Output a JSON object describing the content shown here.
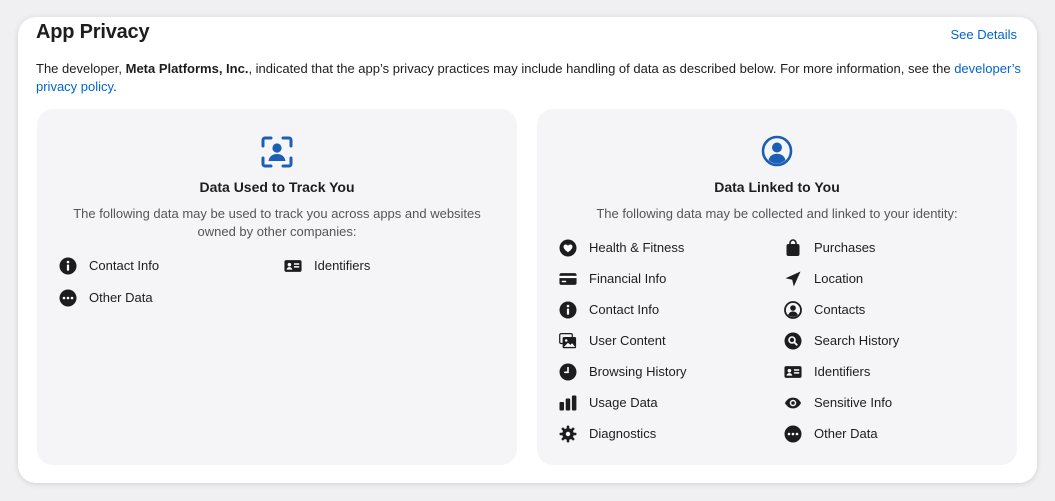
{
  "header": {
    "title": "App Privacy",
    "see_details": "See Details"
  },
  "description": {
    "prefix": "The developer, ",
    "developer": "Meta Platforms, Inc.",
    "middle": ", indicated that the app’s privacy practices may include handling of data as described below. For more information, see the ",
    "link": "developer’s privacy policy",
    "suffix": "."
  },
  "colors": {
    "accent": "#0066cc",
    "panel_bg": "#f5f5f7",
    "icon_blue": "#1a5fb4"
  },
  "track_panel": {
    "icon": "track-you-icon",
    "title": "Data Used to Track You",
    "subtitle": "The following data may be used to track you across apps and websites owned by other companies:",
    "items": [
      {
        "label": "Contact Info",
        "icon": "info-icon"
      },
      {
        "label": "Identifiers",
        "icon": "id-card-icon"
      },
      {
        "label": "Other Data",
        "icon": "ellipsis-icon"
      }
    ]
  },
  "linked_panel": {
    "icon": "person-circle-icon",
    "title": "Data Linked to You",
    "subtitle": "The following data may be collected and linked to your identity:",
    "items": [
      {
        "label": "Health & Fitness",
        "icon": "heart-icon"
      },
      {
        "label": "Purchases",
        "icon": "shopping-bag-icon"
      },
      {
        "label": "Financial Info",
        "icon": "credit-card-icon"
      },
      {
        "label": "Location",
        "icon": "location-arrow-icon"
      },
      {
        "label": "Contact Info",
        "icon": "info-icon"
      },
      {
        "label": "Contacts",
        "icon": "person-circle-icon"
      },
      {
        "label": "User Content",
        "icon": "photo-icon"
      },
      {
        "label": "Search History",
        "icon": "search-icon"
      },
      {
        "label": "Browsing History",
        "icon": "clock-icon"
      },
      {
        "label": "Identifiers",
        "icon": "id-card-icon"
      },
      {
        "label": "Usage Data",
        "icon": "bar-chart-icon"
      },
      {
        "label": "Sensitive Info",
        "icon": "eye-icon"
      },
      {
        "label": "Diagnostics",
        "icon": "gear-icon"
      },
      {
        "label": "Other Data",
        "icon": "ellipsis-icon"
      }
    ]
  }
}
